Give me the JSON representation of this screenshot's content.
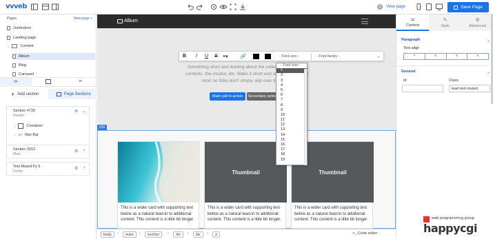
{
  "toolbar": {
    "logo": "vvveb",
    "view_page": "View page",
    "save_label": "Save Page"
  },
  "left": {
    "pages_title": "Pages",
    "new_page": "New page",
    "pages": [
      "Jumbotron",
      "Landing page",
      "Content",
      "Album",
      "Blog",
      "Carousel"
    ],
    "add_section": "Add section",
    "page_sections": "Page Sections",
    "sections": [
      {
        "title": "Section 4733",
        "sub": "Header",
        "children": [
          "Container",
          "Nav Bar"
        ]
      },
      {
        "title": "Section 3312",
        "sub": "Main"
      },
      {
        "title": "Text Muted Py 5",
        "sub": "Footer"
      }
    ]
  },
  "canvas": {
    "nav_title": "Album",
    "hero_text": "Something short and leading about the collection below—its contents, the creator, etc. Make it short and sweet, but not too short so folks don't simply skip over it entirely.",
    "btn_primary": "Main call to action",
    "btn_secondary": "Secondary action",
    "div_tag": "DIV",
    "card_text": "This is a wider card with supporting text below as a natural lead-in to additional content. This content is a little bit longer.",
    "thumb_label": "Thumbnail"
  },
  "rte": {
    "bold": "B",
    "italic": "I",
    "underline": "U",
    "strike": "S",
    "font_size": "- Font size -",
    "font_family": "- Font family -"
  },
  "dropdown": {
    "header": "- Font size -",
    "options": [
      "1",
      "2",
      "3",
      "4",
      "5",
      "6",
      "7",
      "8",
      "9",
      "10",
      "11",
      "12",
      "13",
      "14",
      "15",
      "16",
      "17",
      "18",
      "19"
    ],
    "selected": "1"
  },
  "breadcrumb": [
    "body",
    "main",
    "section",
    "div",
    "div",
    "p"
  ],
  "code_editor": "Code editor",
  "right": {
    "tabs": [
      "Content",
      "Style",
      "Advanced"
    ],
    "paragraph": "Paragraph",
    "text_align": "Text align",
    "general": "General",
    "id_label": "Id",
    "class_label": "Class",
    "class_value": "lead text-muted"
  },
  "watermark": {
    "line1": "web programming group",
    "line2": "happycgi"
  },
  "colors": {
    "accent": "#1a73e8",
    "navbar": "#2b2b2b",
    "section_bg": "#e9e9e9"
  }
}
